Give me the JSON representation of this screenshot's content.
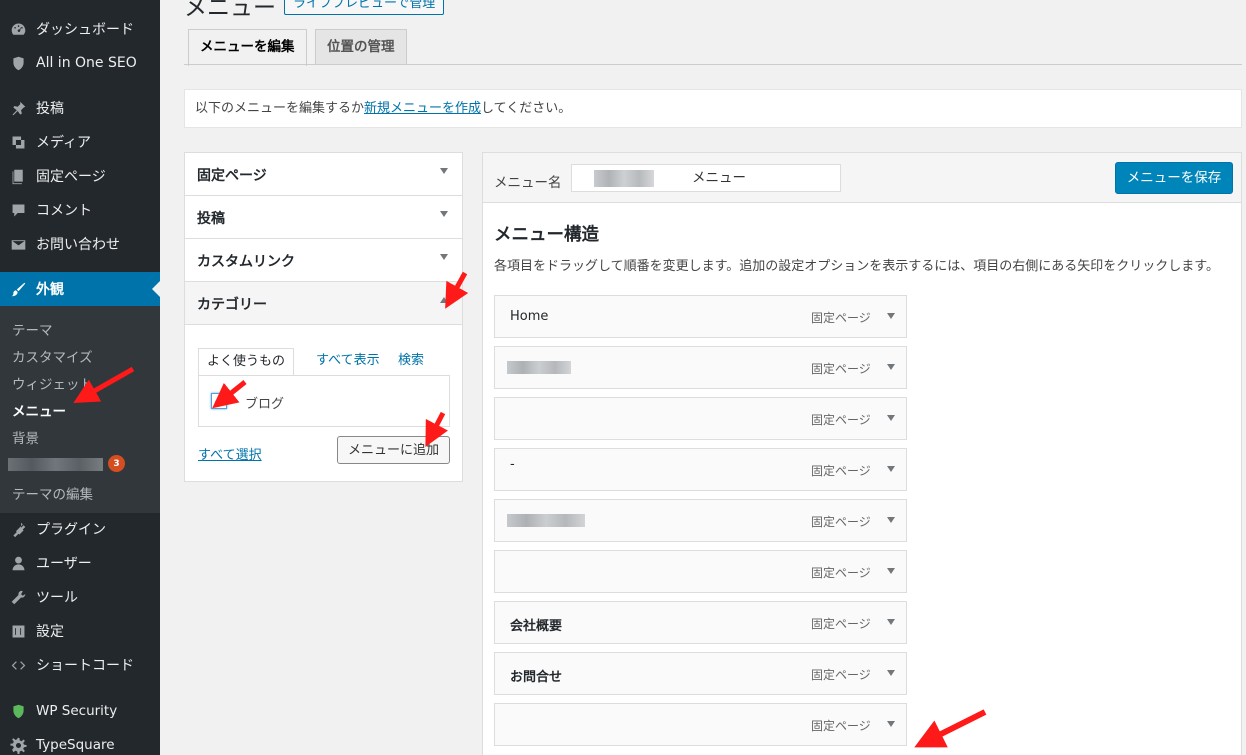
{
  "sidebar": {
    "items": [
      {
        "label": "ダッシュボード",
        "icon": "dashboard-icon"
      },
      {
        "label": "All in One SEO",
        "icon": "shield-icon"
      },
      {
        "label": "投稿",
        "icon": "pin-icon"
      },
      {
        "label": "メディア",
        "icon": "media-icon"
      },
      {
        "label": "固定ページ",
        "icon": "page-icon"
      },
      {
        "label": "コメント",
        "icon": "comment-icon"
      },
      {
        "label": "お問い合わせ",
        "icon": "mail-icon"
      },
      {
        "label": "外観",
        "icon": "brush-icon",
        "active": true
      },
      {
        "label": "プラグイン",
        "icon": "plugin-icon"
      },
      {
        "label": "ユーザー",
        "icon": "user-icon"
      },
      {
        "label": "ツール",
        "icon": "wrench-icon"
      },
      {
        "label": "設定",
        "icon": "settings-icon"
      },
      {
        "label": "ショートコード",
        "icon": "code-icon"
      },
      {
        "label": "WP Security",
        "icon": "security-shield-icon"
      },
      {
        "label": "TypeSquare",
        "icon": "gear-icon"
      }
    ],
    "submenu": [
      {
        "label": "テーマ"
      },
      {
        "label": "カスタマイズ"
      },
      {
        "label": "ウィジェット"
      },
      {
        "label": "メニュー",
        "current": true
      },
      {
        "label": "背景"
      },
      {
        "label": "",
        "badge": "3"
      },
      {
        "label": "テーマの編集"
      }
    ]
  },
  "header": {
    "title": "メニュー",
    "live_preview_label": "ライブプレビューで管理"
  },
  "tabs": [
    {
      "label": "メニューを編集",
      "active": true
    },
    {
      "label": "位置の管理"
    }
  ],
  "notice": {
    "prefix": "以下のメニューを編集するか",
    "link": "新規メニューを作成",
    "suffix": "してください。"
  },
  "accordion": {
    "sections": [
      {
        "label": "固定ページ"
      },
      {
        "label": "投稿"
      },
      {
        "label": "カスタムリンク"
      },
      {
        "label": "カテゴリー",
        "open": true
      }
    ],
    "category_tabs": [
      {
        "label": "よく使うもの",
        "active": true
      },
      {
        "label": "すべて表示"
      },
      {
        "label": "検索"
      }
    ],
    "categories": [
      {
        "label": "ブログ",
        "checked": true
      }
    ],
    "select_all_label": "すべて選択",
    "add_button_label": "メニューに追加"
  },
  "menu_editor": {
    "menu_name_label": "メニュー名",
    "menu_name_value": "メニュー",
    "save_button_label": "メニューを保存",
    "structure_title": "メニュー構造",
    "structure_description": "各項目をドラッグして順番を変更します。追加の設定オプションを表示するには、項目の右側にある矢印をクリックします。",
    "items": [
      {
        "title": "Home",
        "type": "固定ページ"
      },
      {
        "title": "",
        "type": "固定ページ"
      },
      {
        "title": "",
        "type": "固定ページ"
      },
      {
        "title": "-",
        "type": "固定ページ"
      },
      {
        "title": "",
        "type": "固定ページ"
      },
      {
        "title": "",
        "type": "固定ページ"
      },
      {
        "title": "会社概要",
        "type": "固定ページ"
      },
      {
        "title": "お問合せ",
        "type": "固定ページ"
      },
      {
        "title": "",
        "type": "固定ページ"
      }
    ]
  },
  "colors": {
    "sidebar_bg": "#23282d",
    "submenu_bg": "#32373c",
    "accent": "#0073aa",
    "primary_button": "#0085ba",
    "badge": "#d54e21",
    "annotation": "#ff0000"
  }
}
